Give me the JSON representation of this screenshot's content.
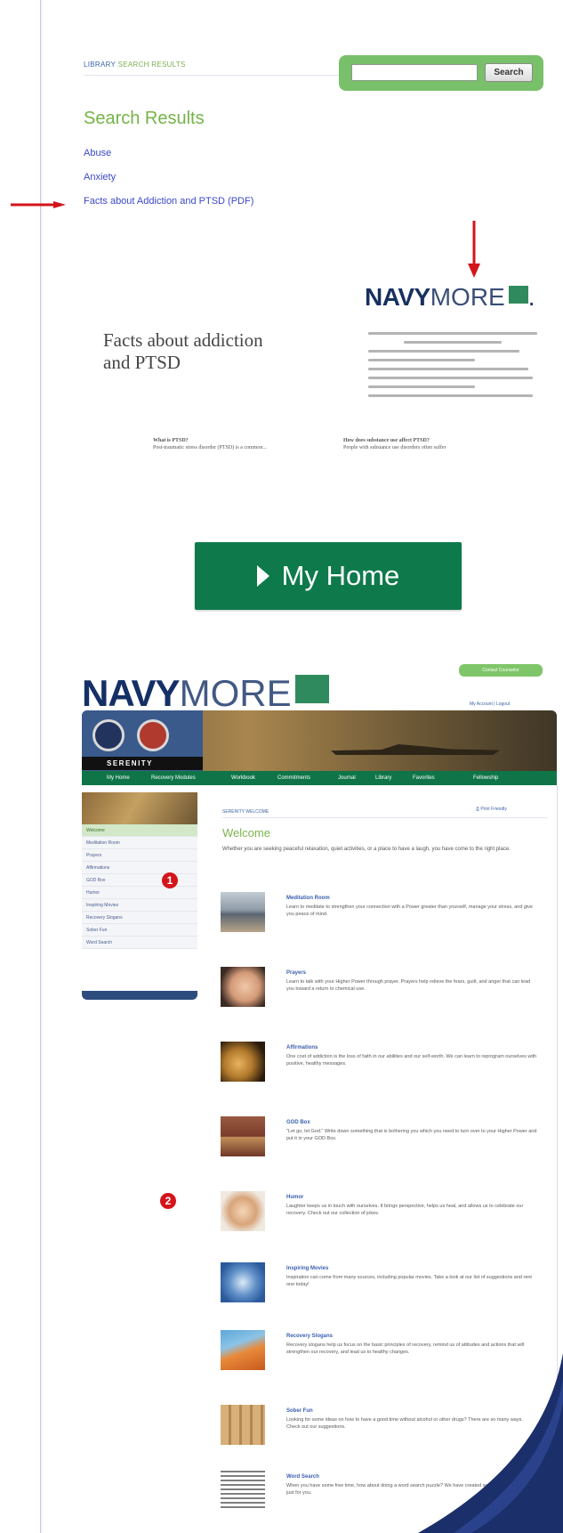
{
  "search_results": {
    "breadcrumb_library": "LIBRARY",
    "breadcrumb_current": "SEARCH RESULTS",
    "search_button": "Search",
    "search_value": "",
    "title": "Search Results",
    "results": [
      "Abuse",
      "Anxiety",
      "Facts about Addiction and PTSD (PDF)"
    ]
  },
  "pdf_preview": {
    "logo_navy": "NAVY",
    "logo_more": "MORE",
    "title": "Facts about addiction and PTSD",
    "sub_left_title": "What is PTSD?",
    "sub_left_text": "Post-traumatic stress disorder (PTSD) is a common...",
    "sub_right_title": "How does substance use affect PTSD?",
    "sub_right_text": "People with substance use disorders often suffer"
  },
  "my_home": {
    "label": "My Home"
  },
  "site": {
    "logo_navy": "NAVY",
    "logo_more": "MORE",
    "contact_button": "Contact Counselor",
    "account_links": "My Account | Logout",
    "program_name": "SERENITY",
    "nav": [
      "My Home",
      "Recovery Modules",
      "Workbook",
      "Commitments",
      "Journal",
      "Library",
      "Favorites",
      "Fellowship"
    ],
    "sidebar": [
      "Welcome",
      "Meditation Room",
      "Prayers",
      "Affirmations",
      "GOD Box",
      "Humor",
      "Inspiring Movies",
      "Recovery Slogans",
      "Sober Fun",
      "Word Search"
    ],
    "badges": [
      "1",
      "2"
    ],
    "breadcrumb": "SERENITY WELCOME",
    "print_link": "Print Friendly",
    "welcome_title": "Welcome",
    "welcome_intro": "Whether you are seeking peaceful relaxation, quiet activities, or a place to have a laugh, you have come to the right place.",
    "modules": [
      {
        "title": "Meditation Room",
        "desc": "Learn to meditate to strengthen your connection with a Power greater than yourself, manage your stress, and give you peace of mind."
      },
      {
        "title": "Prayers",
        "desc": "Learn to talk with your Higher Power through prayer. Prayers help relieve the fears, guilt, and anger that can lead you toward a return to chemical use."
      },
      {
        "title": "Affirmations",
        "desc": "One cost of addiction is the loss of faith in our abilities and our self-worth. We can learn to reprogram ourselves with positive, healthy messages."
      },
      {
        "title": "GOD Box",
        "desc": "\"Let go, let God.\" Write down something that is bothering you which you need to turn over to your Higher Power and put it in your GOD Box."
      },
      {
        "title": "Humor",
        "desc": "Laughter keeps us in touch with ourselves. It brings perspective, helps us heal, and allows us to celebrate our recovery. Check out our collection of jokes."
      },
      {
        "title": "Inspiring Movies",
        "desc": "Inspiration can come from many sources, including popular movies. Take a look at our list of suggestions and rent one today!"
      },
      {
        "title": "Recovery Slogans",
        "desc": "Recovery slogans help us focus on the basic principles of recovery, remind us of attitudes and actions that will strengthen our recovery, and lead us to healthy changes."
      },
      {
        "title": "Sober Fun",
        "desc": "Looking for some ideas on how to have a good time without alcohol or other drugs? There are so many ways. Check out our suggestions."
      },
      {
        "title": "Word Search",
        "desc": "When you have some free time, how about doing a word search puzzle? We have created several word searches just for you."
      }
    ]
  },
  "colors": {
    "green_accent": "#75b347",
    "navy_brand": "#17305f",
    "home_button": "#0e7a4c",
    "link_blue": "#3a48c8",
    "badge_red": "#d4141b"
  }
}
